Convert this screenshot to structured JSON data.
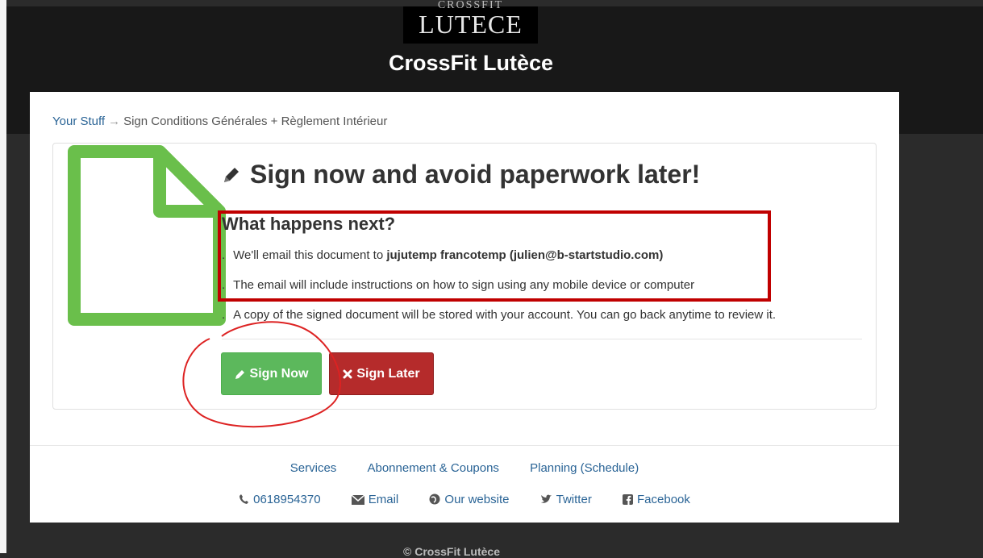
{
  "logo": {
    "top_word": "CROSSFIT",
    "main_word": "LUTECE"
  },
  "header": {
    "title": "CrossFit Lutèce"
  },
  "breadcrumb": {
    "link": "Your Stuff",
    "arrow": "→",
    "current": "Sign Conditions Générales + Règlement Intérieur"
  },
  "card": {
    "heading": "Sign now and avoid paperwork later!",
    "subheading": "What happens next?",
    "item1_prefix": "We'll email this document to ",
    "item1_recipient": "jujutemp francotemp (julien@b-startstudio.com)",
    "item2": "The email will include instructions on how to sign using any mobile device or computer",
    "item3": "A copy of the signed document will be stored with your account. You can go back anytime to review it.",
    "bullet": "."
  },
  "buttons": {
    "sign_now": "Sign Now",
    "sign_later": "Sign Later"
  },
  "footer": {
    "links": [
      "Services",
      "Abonnement & Coupons",
      "Planning (Schedule)"
    ],
    "phone": "0618954370",
    "email": "Email",
    "website": "Our website",
    "twitter": "Twitter",
    "facebook": "Facebook"
  },
  "copyright": "© CrossFit Lutèce",
  "colors": {
    "accent_green": "#5cb85c",
    "danger_red": "#b52b2b",
    "annotation_red": "#c00000",
    "doc_icon_green": "#6abf4b",
    "link_blue": "#2a6496"
  },
  "icons": [
    "pencil-icon",
    "times-icon",
    "phone-icon",
    "envelope-icon",
    "globe-icon",
    "twitter-icon",
    "facebook-icon",
    "document-icon"
  ]
}
